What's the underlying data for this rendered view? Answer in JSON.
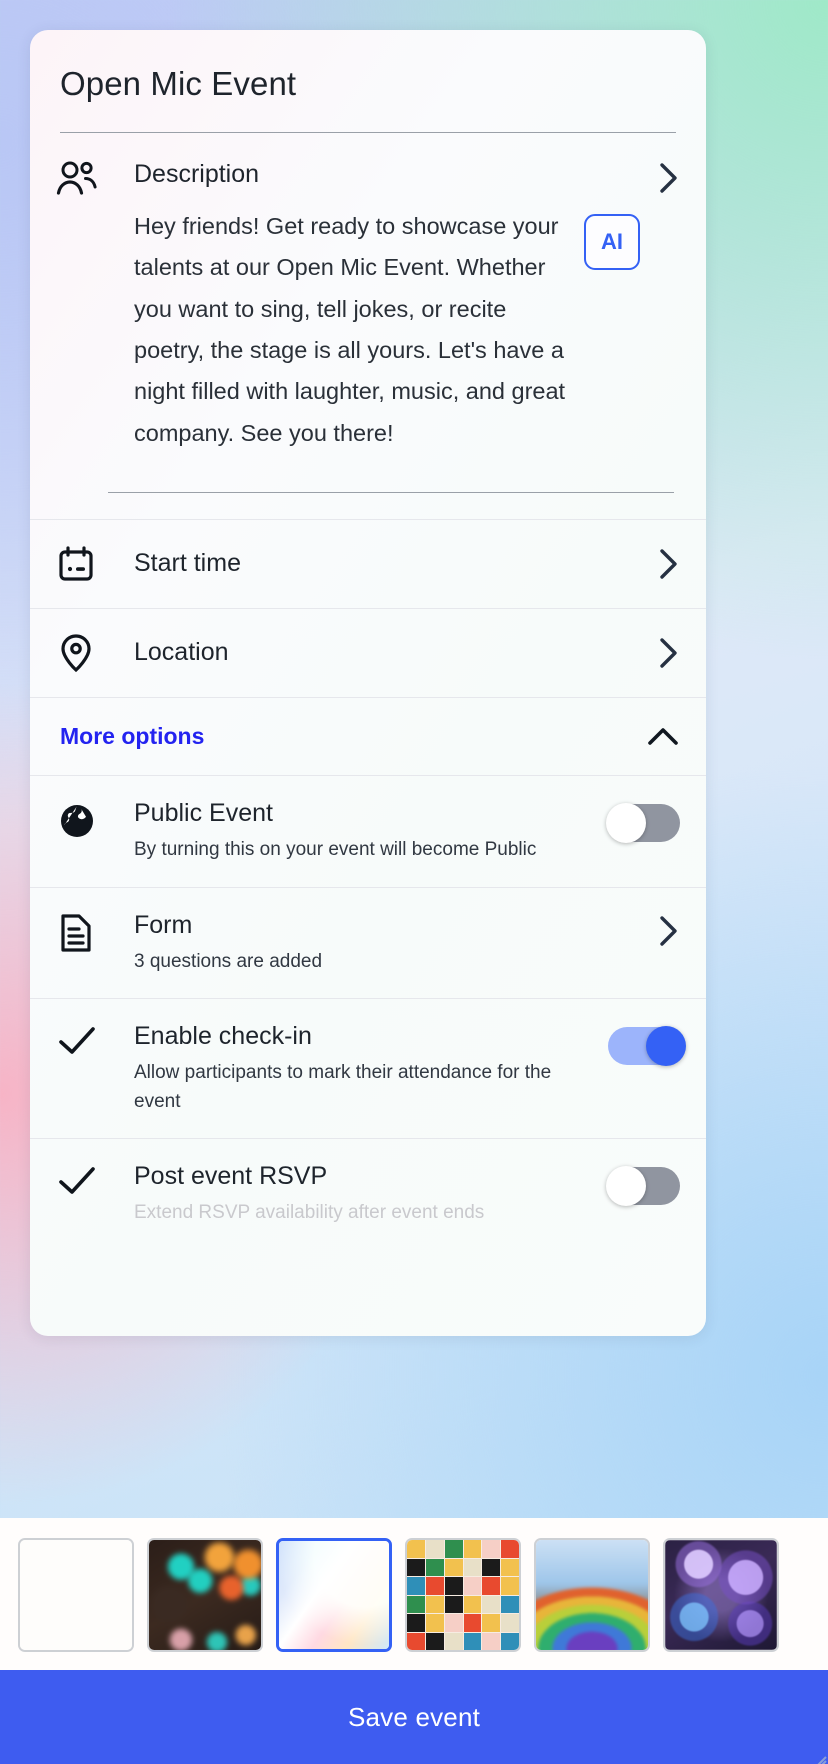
{
  "card": {
    "title": "Open Mic Event",
    "description": {
      "icon": "people-icon",
      "label": "Description",
      "text": "Hey friends!  Get ready to showcase your talents at our Open Mic Event. Whether you want to sing, tell jokes, or recite poetry, the stage is all yours. Let's have a night filled with laughter, music, and great company. See you there!",
      "ai_badge": "AI"
    },
    "rows": [
      {
        "icon": "calendar-icon",
        "label": "Start time"
      },
      {
        "icon": "location-pin-icon",
        "label": "Location"
      }
    ],
    "more_options": {
      "label": "More options",
      "expanded": true,
      "chevron": "chevron-up-icon"
    },
    "options": [
      {
        "key": "public-event",
        "icon": "globe-icon",
        "title": "Public Event",
        "subtitle": "By turning this on your event will become Public",
        "control": "toggle",
        "state": "off"
      },
      {
        "key": "form",
        "icon": "document-icon",
        "title": "Form",
        "subtitle": "3 questions are added",
        "control": "chevron",
        "state": ""
      },
      {
        "key": "enable-check-in",
        "icon": "check-icon",
        "title": "Enable check-in",
        "subtitle": "Allow participants to mark their attendance for the event",
        "control": "toggle",
        "state": "on"
      },
      {
        "key": "post-event-rsvp",
        "icon": "check-icon",
        "title": "Post event RSVP",
        "subtitle": "Extend RSVP availability after event ends",
        "control": "toggle",
        "state": "off"
      }
    ]
  },
  "themes": {
    "selected_index": 2,
    "items": [
      {
        "name": "blank-theme"
      },
      {
        "name": "bokeh-lights-theme"
      },
      {
        "name": "pastel-gradient-theme"
      },
      {
        "name": "geometric-pattern-theme"
      },
      {
        "name": "rainbow-road-theme"
      },
      {
        "name": "bubbles-theme"
      }
    ]
  },
  "footer": {
    "save_label": "Save event"
  },
  "colors": {
    "accent_blue": "#3461f5",
    "link_blue": "#2323f0",
    "save_button": "#3e5cf0",
    "toggle_off": "#9095a0",
    "toggle_on_track": "#9cb4fb"
  }
}
